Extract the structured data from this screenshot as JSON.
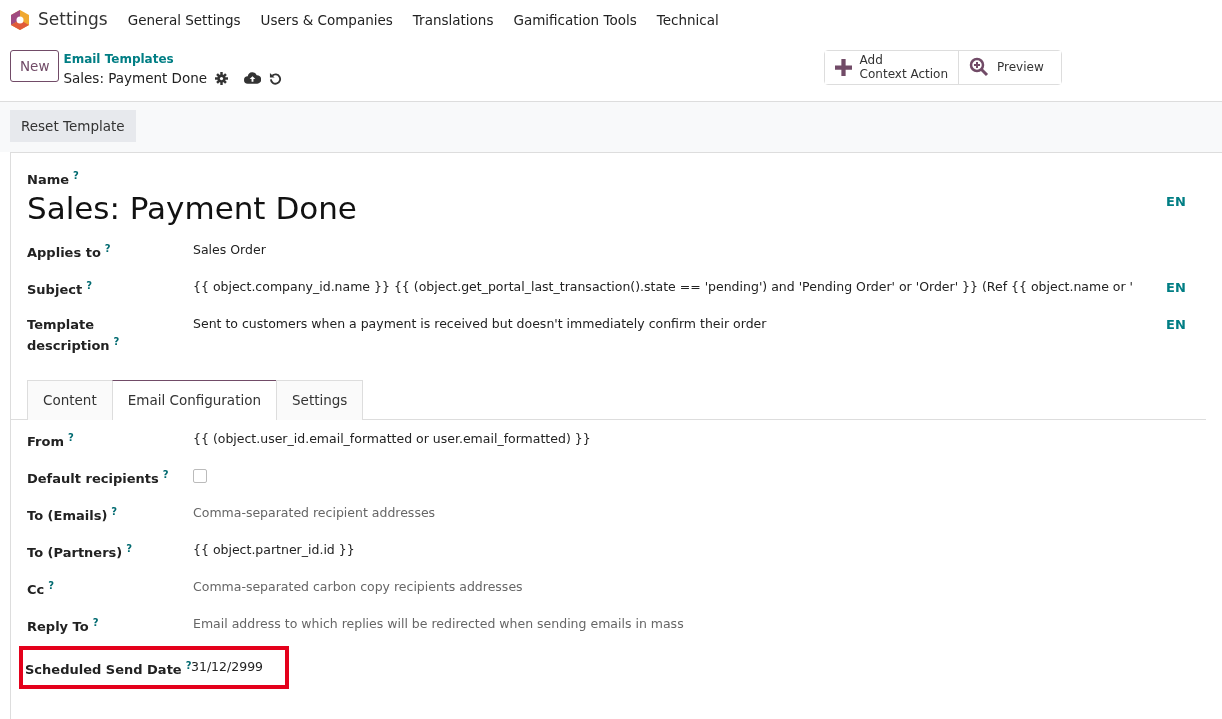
{
  "navbar": {
    "app": "Settings",
    "menu": [
      "General Settings",
      "Users & Companies",
      "Translations",
      "Gamification Tools",
      "Technical"
    ]
  },
  "control_panel": {
    "new_button": "New",
    "breadcrumb": "Email Templates",
    "record": "Sales: Payment Done",
    "actions": [
      {
        "kind": "add",
        "label": "Add\nContext Action"
      },
      {
        "kind": "preview",
        "label": "Preview"
      }
    ]
  },
  "statusbar": {
    "button": "Reset Template"
  },
  "form": {
    "help": "?",
    "name_label": "Name",
    "name": "Sales: Payment Done",
    "name_lang": "EN",
    "fields": [
      {
        "label": "Applies to",
        "value": "Sales Order"
      },
      {
        "label": "Subject",
        "value": "{{ object.company_id.name }} {{ (object.get_portal_last_transaction().state == 'pending') and 'Pending Order' or 'Order' }} (Ref {{ object.name or '",
        "lang": "EN"
      },
      {
        "label": "Template description",
        "value": "Sent to customers when a payment is received but doesn't immediately confirm their order",
        "lang": "EN"
      }
    ],
    "tabs": [
      {
        "label": "Content",
        "selected": false
      },
      {
        "label": "Email Configuration",
        "selected": true
      },
      {
        "label": "Settings",
        "selected": false
      }
    ],
    "tab_fields": [
      {
        "kind": "text",
        "label": "From",
        "value": "{{ (object.user_id.email_formatted or user.email_formatted) }}"
      },
      {
        "kind": "checkbox",
        "label": "Default recipients",
        "checked": false
      },
      {
        "kind": "text",
        "label": "To (Emails)",
        "placeholder": "Comma-separated recipient addresses"
      },
      {
        "kind": "text",
        "label": "To (Partners)",
        "value": "{{ object.partner_id.id }}"
      },
      {
        "kind": "text",
        "label": "Cc",
        "placeholder": "Comma-separated carbon copy recipients addresses"
      },
      {
        "kind": "text",
        "label": "Reply To",
        "placeholder": "Email address to which replies will be redirected when sending emails in mass"
      },
      {
        "kind": "text",
        "label": "Scheduled Send Date",
        "value": "31/12/2999",
        "highlighted": true
      }
    ]
  }
}
